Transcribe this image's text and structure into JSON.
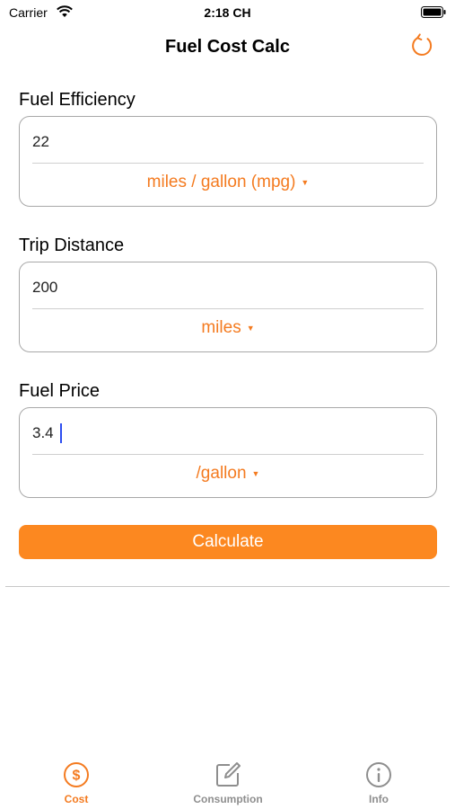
{
  "status_bar": {
    "carrier": "Carrier",
    "time": "2:18 CH"
  },
  "nav": {
    "title": "Fuel Cost Calc",
    "refresh_icon": "refresh-icon"
  },
  "fields": [
    {
      "label": "Fuel Efficiency",
      "value": "22",
      "unit": "miles / gallon (mpg)"
    },
    {
      "label": "Trip Distance",
      "value": "200",
      "unit": "miles"
    },
    {
      "label": "Fuel Price",
      "value": "3.4",
      "unit": "/gallon"
    }
  ],
  "calculate_label": "Calculate",
  "tabs": [
    {
      "label": "Cost",
      "icon": "dollar-circle-icon",
      "selected": true
    },
    {
      "label": "Consumption",
      "icon": "edit-icon",
      "selected": false
    },
    {
      "label": "Info",
      "icon": "info-icon",
      "selected": false
    }
  ],
  "colors": {
    "accent": "#f47b20",
    "button": "#fc8820",
    "inactive": "#8e8e8e"
  }
}
